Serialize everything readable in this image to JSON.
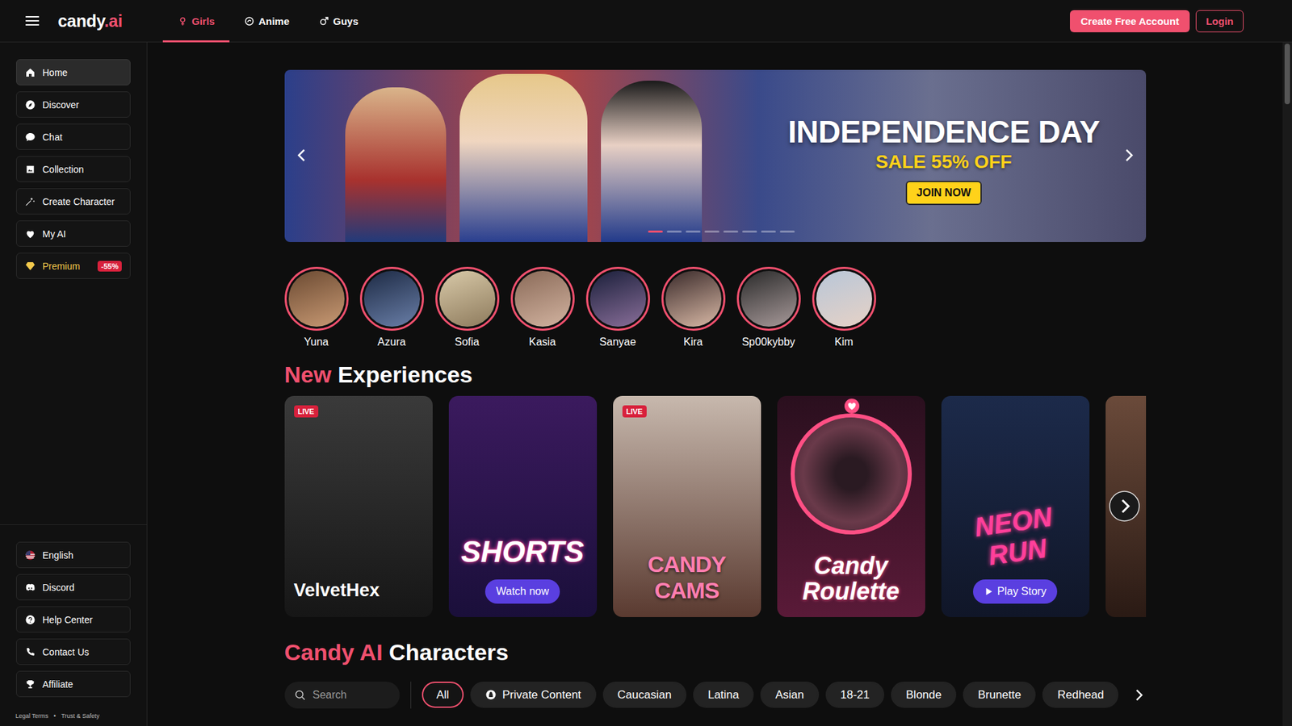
{
  "logo": {
    "name": "candy",
    "suffix": ".ai"
  },
  "nav_tabs": [
    {
      "label": "Girls",
      "selected": true
    },
    {
      "label": "Anime",
      "selected": false
    },
    {
      "label": "Guys",
      "selected": false
    }
  ],
  "header_buttons": {
    "signup": "Create Free Account",
    "login": "Login"
  },
  "sidebar": {
    "items": [
      {
        "label": "Home",
        "selected": true
      },
      {
        "label": "Discover",
        "selected": false
      },
      {
        "label": "Chat",
        "selected": false
      },
      {
        "label": "Collection",
        "selected": false
      },
      {
        "label": "Create Character",
        "selected": false
      },
      {
        "label": "My AI",
        "selected": false
      },
      {
        "label": "Premium",
        "selected": false,
        "badge": "-55%"
      }
    ],
    "footer_items": [
      "English",
      "Discord",
      "Help Center",
      "Contact Us",
      "Affiliate"
    ],
    "legal": {
      "links": [
        "Legal Terms",
        "Trust & Safety"
      ],
      "separator": "•"
    }
  },
  "banner": {
    "title": "INDEPENDENCE DAY",
    "subtitle": "SALE 55% OFF",
    "button": "JOIN NOW",
    "dots": [
      {
        "selected": true
      },
      {
        "selected": false
      },
      {
        "selected": false
      },
      {
        "selected": false
      },
      {
        "selected": false
      },
      {
        "selected": false
      },
      {
        "selected": false
      },
      {
        "selected": false
      }
    ]
  },
  "stories": [
    "Yuna",
    "Azura",
    "Sofia",
    "Kasia",
    "Sanyae",
    "Kira",
    "Sp00kybby",
    "Kim"
  ],
  "experiences": {
    "title_accent": "New",
    "title": "Experiences",
    "live_badge": "LIVE",
    "cards": [
      {
        "kind": "name",
        "live": true,
        "title": "VelvetHex",
        "button": ""
      },
      {
        "kind": "shorts",
        "live": false,
        "title": "SHORTS",
        "button": "Watch now"
      },
      {
        "kind": "cams",
        "live": true,
        "title": "CANDY CAMS",
        "button": ""
      },
      {
        "kind": "roulette",
        "live": false,
        "title": "Candy Roulette",
        "button": ""
      },
      {
        "kind": "story",
        "live": false,
        "title": "NEON RUN",
        "button": "Play Story"
      },
      {
        "kind": "partial",
        "live": false,
        "title": "",
        "button": ""
      }
    ]
  },
  "characters": {
    "title_accent": "Candy AI",
    "title": "Characters",
    "search_placeholder": "Search",
    "filters": [
      {
        "label": "All",
        "selected": true
      },
      {
        "label": "Private Content",
        "selected": false
      },
      {
        "label": "Caucasian",
        "selected": false
      },
      {
        "label": "Latina",
        "selected": false
      },
      {
        "label": "Asian",
        "selected": false
      },
      {
        "label": "18-21",
        "selected": false
      },
      {
        "label": "Blonde",
        "selected": false
      },
      {
        "label": "Brunette",
        "selected": false
      },
      {
        "label": "Redhead",
        "selected": false
      }
    ]
  }
}
